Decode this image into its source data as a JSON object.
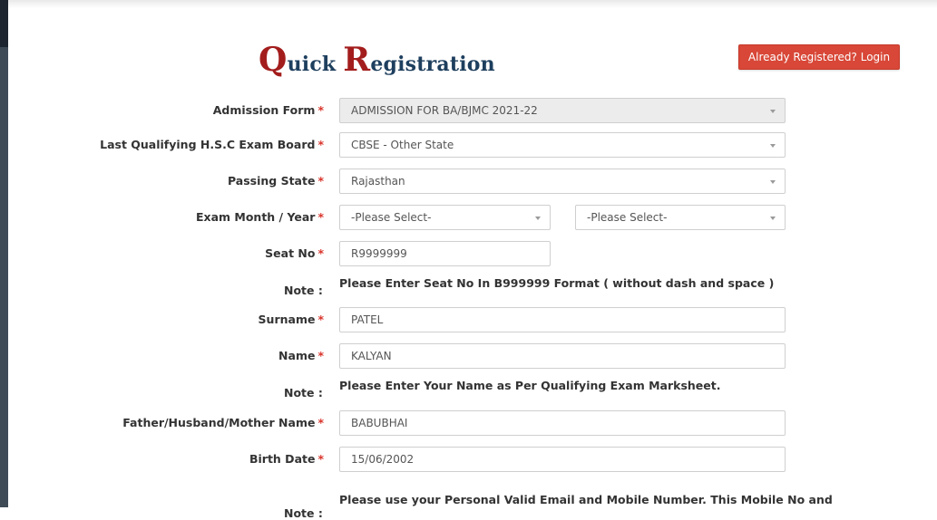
{
  "header": {
    "title_cap1": "Q",
    "title_rest1": "uick",
    "title_cap2": "R",
    "title_rest2": "egistration",
    "login_button": "Already Registered? Login"
  },
  "required_marker": "*",
  "form": {
    "admission_form": {
      "label": "Admission Form",
      "value": "ADMISSION FOR BA/BJMC 2021-22"
    },
    "exam_board": {
      "label": "Last Qualifying H.S.C Exam Board",
      "value": "CBSE - Other State"
    },
    "passing_state": {
      "label": "Passing State",
      "value": "Rajasthan"
    },
    "exam_month_year": {
      "label": "Exam Month / Year",
      "month_value": "-Please Select-",
      "year_value": "-Please Select-"
    },
    "seat_no": {
      "label": "Seat No",
      "value": "R9999999"
    },
    "note1": {
      "label": "Note :",
      "text": "Please Enter Seat No In B999999 Format ( without dash and space )"
    },
    "surname": {
      "label": "Surname",
      "value": "PATEL"
    },
    "name": {
      "label": "Name",
      "value": "KALYAN"
    },
    "note2": {
      "label": "Note :",
      "text": "Please Enter Your Name as Per Qualifying Exam Marksheet."
    },
    "father_name": {
      "label": "Father/Husband/Mother Name",
      "value": "BABUBHAI"
    },
    "birth_date": {
      "label": "Birth Date",
      "value": "15/06/2002"
    },
    "note3": {
      "label": "Note :",
      "text": "Please use your Personal Valid Email and Mobile Number. This Mobile No and"
    }
  },
  "colors": {
    "title_blue": "#1e3f5e",
    "title_red": "#a31d1d",
    "login_button_bg": "#d84737",
    "required_red": "#d9342b"
  }
}
